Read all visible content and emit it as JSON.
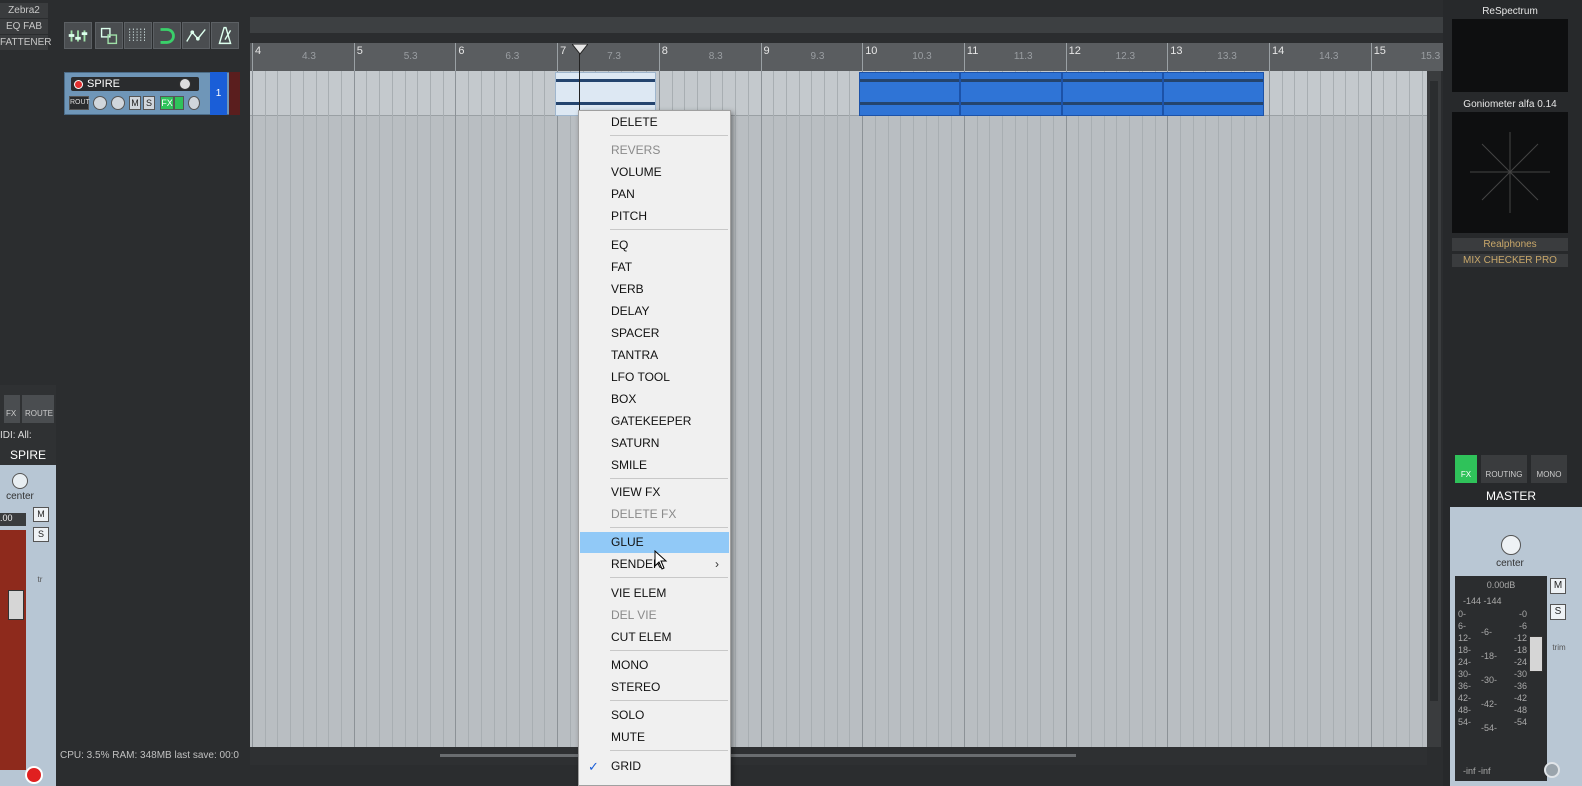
{
  "plugins": [
    "Zebra2",
    "EQ FAB",
    "FATTENER"
  ],
  "ruler": {
    "numbers": [
      "4",
      "5",
      "6",
      "7",
      "8",
      "9",
      "10",
      "11",
      "12",
      "13",
      "14",
      "15"
    ],
    "subs": [
      "4.3",
      "5.3",
      "6.3",
      "7.3",
      "8.3",
      "9.3",
      "10.3",
      "11.3",
      "12.3",
      "13.3",
      "14.3",
      "15.3"
    ]
  },
  "track": {
    "name": "SPIRE",
    "number": "1",
    "route_label": "ROUT",
    "mute": "M",
    "solo": "S",
    "fx": "FX"
  },
  "status": "CPU: 3.5% RAM: 348MB last save: 00:0",
  "left_strip": {
    "fx": "FX",
    "route": "ROUTE",
    "midi": "IDI: All:",
    "name": "SPIRE",
    "pan": "center",
    "vol": ".00",
    "m": "M",
    "s": "S",
    "trim": "tr"
  },
  "right_panel": {
    "respectrum": "ReSpectrum",
    "goniometer": "Goniometer alfa 0.14",
    "realphones": "Realphones",
    "mixchecker": "MIX CHECKER PRO",
    "fx": "FX",
    "routing": "ROUTING",
    "mono": "MONO",
    "master": "MASTER",
    "pan": "center",
    "db": "0.00dB",
    "m": "M",
    "s": "S",
    "trim": "trim",
    "meter_top": "-144  -144",
    "meter_scale_left": [
      "0-",
      "6-",
      "12-",
      "18-",
      "24-",
      "30-",
      "36-",
      "42-",
      "48-",
      "54-"
    ],
    "meter_scale_right": [
      "-0",
      "-6",
      "-12",
      "-18",
      "-24",
      "-30",
      "-36",
      "-42",
      "-48",
      "-54"
    ],
    "meter_mid": [
      "-6-",
      "-18-",
      "-30-",
      "-42-",
      "-54-"
    ],
    "meter_bottom": "-inf  -inf"
  },
  "context_menu": {
    "items": [
      {
        "label": "DELETE",
        "state": "normal"
      },
      {
        "label": "REVERS",
        "state": "disabled"
      },
      {
        "label": "VOLUME",
        "state": "normal"
      },
      {
        "label": "PAN",
        "state": "normal"
      },
      {
        "label": "PITCH",
        "state": "normal"
      },
      {
        "label": "EQ",
        "state": "normal"
      },
      {
        "label": "FAT",
        "state": "normal"
      },
      {
        "label": "VERB",
        "state": "normal"
      },
      {
        "label": "DELAY",
        "state": "normal"
      },
      {
        "label": "SPACER",
        "state": "normal"
      },
      {
        "label": "TANTRA",
        "state": "normal"
      },
      {
        "label": "LFO TOOL",
        "state": "normal"
      },
      {
        "label": "BOX",
        "state": "normal"
      },
      {
        "label": "GATEKEEPER",
        "state": "normal"
      },
      {
        "label": "SATURN",
        "state": "normal"
      },
      {
        "label": "SMILE",
        "state": "normal"
      },
      {
        "label": "VIEW FX",
        "state": "normal"
      },
      {
        "label": "DELETE FX",
        "state": "disabled"
      },
      {
        "label": "GLUE",
        "state": "highlighted"
      },
      {
        "label": "RENDER",
        "state": "submenu"
      },
      {
        "label": "VIE ELEM",
        "state": "normal"
      },
      {
        "label": "DEL VIE",
        "state": "disabled"
      },
      {
        "label": "CUT ELEM",
        "state": "normal"
      },
      {
        "label": "MONO",
        "state": "normal"
      },
      {
        "label": "STEREO",
        "state": "normal"
      },
      {
        "label": "SOLO",
        "state": "normal"
      },
      {
        "label": "MUTE",
        "state": "normal"
      },
      {
        "label": "GRID",
        "state": "checked"
      }
    ]
  },
  "colors": {
    "selected_item": "#2f74d6",
    "menu_highlight": "#91c9f7",
    "track_color": "#1a5ed8"
  }
}
